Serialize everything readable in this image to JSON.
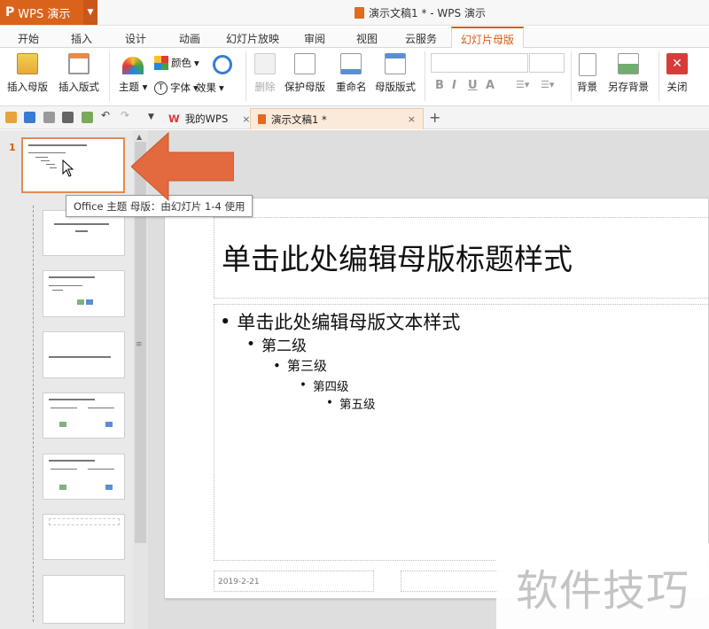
{
  "app": {
    "logo": "P",
    "name": "WPS 演示"
  },
  "window": {
    "title": "演示文稿1 * - WPS 演示"
  },
  "ribbon_tabs": [
    "开始",
    "插入",
    "设计",
    "动画",
    "幻灯片放映",
    "审阅",
    "视图",
    "云服务",
    "幻灯片母版"
  ],
  "active_tab": "幻灯片母版",
  "ribbon": {
    "insert_master": "插入母版",
    "insert_layout": "插入版式",
    "theme": "主题",
    "color": "颜色",
    "font": "字体",
    "effect": "效果",
    "delete": "删除",
    "protect_master": "保护母版",
    "rename": "重命名",
    "master_layout": "母版版式",
    "bold": "B",
    "italic": "I",
    "underline": "U",
    "font_color": "A",
    "background": "背景",
    "save_background": "另存背景",
    "close": "关闭"
  },
  "doc_tabs": [
    {
      "label": "我的WPS",
      "close": "×"
    },
    {
      "label": "演示文稿1 *",
      "close": "×"
    }
  ],
  "new_tab": "+",
  "slide_panel": {
    "first_slide_number": "1"
  },
  "tooltip": "Office 主题 母版：由幻灯片 1-4 使用",
  "slide": {
    "title": "单击此处编辑母版标题样式",
    "levels": [
      "单击此处编辑母版文本样式",
      "第二级",
      "第三级",
      "第四级",
      "第五级"
    ],
    "date": "2019-2-21"
  },
  "watermark": "软件技巧",
  "colors": {
    "accent": "#d85c14",
    "arrow": "#e36a3e"
  }
}
